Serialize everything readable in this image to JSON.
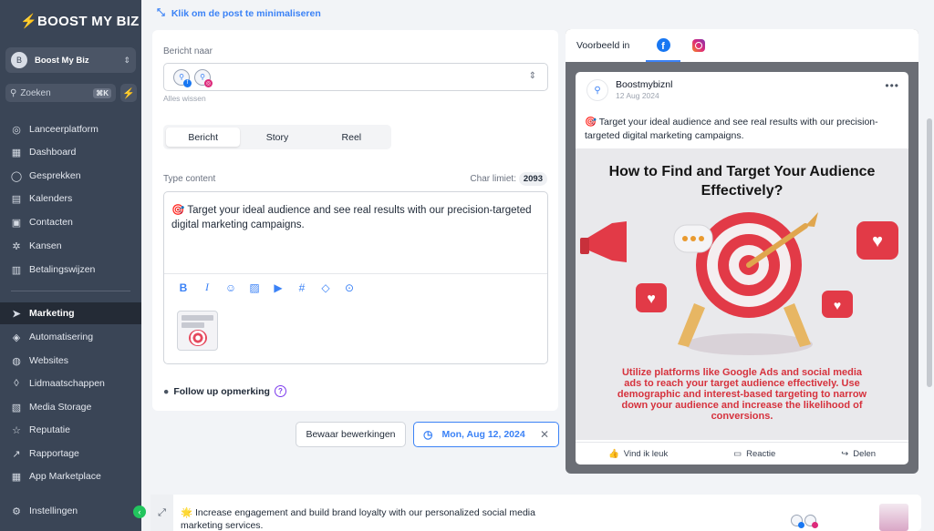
{
  "app": {
    "brand": "BOOST MY BIZ",
    "account_name": "Boost My Biz",
    "account_initial": "B",
    "search_placeholder": "Zoeken",
    "search_shortcut": "⌘K"
  },
  "sidebar": {
    "items": [
      {
        "label": "Lanceerplatform",
        "icon": "rocket-icon"
      },
      {
        "label": "Dashboard",
        "icon": "dashboard-icon"
      },
      {
        "label": "Gesprekken",
        "icon": "chat-icon"
      },
      {
        "label": "Kalenders",
        "icon": "calendar-icon"
      },
      {
        "label": "Contacten",
        "icon": "contacts-icon"
      },
      {
        "label": "Kansen",
        "icon": "opportunities-icon"
      },
      {
        "label": "Betalingswijzen",
        "icon": "payments-icon"
      },
      {
        "label": "Marketing",
        "icon": "send-icon",
        "active": true
      },
      {
        "label": "Automatisering",
        "icon": "automation-icon"
      },
      {
        "label": "Websites",
        "icon": "globe-icon"
      },
      {
        "label": "Lidmaatschappen",
        "icon": "membership-icon"
      },
      {
        "label": "Media Storage",
        "icon": "image-icon"
      },
      {
        "label": "Reputatie",
        "icon": "star-icon"
      },
      {
        "label": "Rapportage",
        "icon": "trend-icon"
      },
      {
        "label": "App Marketplace",
        "icon": "grid-icon"
      },
      {
        "label": "Instellingen",
        "icon": "gear-icon"
      }
    ]
  },
  "top": {
    "minimize_label": "Klik om de post te minimaliseren"
  },
  "editor": {
    "recipients_label": "Bericht naar",
    "clear_all": "Alles wissen",
    "tabs": [
      {
        "label": "Bericht",
        "active": true
      },
      {
        "label": "Story"
      },
      {
        "label": "Reel"
      }
    ],
    "content_label": "Type content",
    "char_limit_label": "Char limiet:",
    "char_limit_value": "2093",
    "content_emoji": "🎯",
    "content_text": "Target your ideal audience and see real results with our precision-targeted digital marketing campaigns.",
    "toolbar": [
      "bold-icon",
      "italic-icon",
      "emoji-icon",
      "image-icon",
      "video-icon",
      "hashtag-icon",
      "tag-icon",
      "location-icon"
    ],
    "followup_label": "Follow up opmerking"
  },
  "actions": {
    "save_label": "Bewaar bewerkingen",
    "date_label": "Mon, Aug 12, 2024"
  },
  "preview": {
    "label": "Voorbeeld in",
    "page_name": "Boostmybiznl",
    "post_date": "12 Aug 2024",
    "post_text": "🎯 Target your ideal audience and see real results with our precision-targeted digital marketing campaigns.",
    "image_title": "How to Find and Target Your Audience Effectively?",
    "image_body": "Utilize platforms like Google Ads and social media ads to reach your target audience effectively. Use demographic and interest-based targeting to narrow down your audience and increase the likelihood of conversions.",
    "like_label": "Vind ik leuk",
    "comment_label": "Reactie",
    "share_label": "Delen"
  },
  "bottom_post": {
    "emoji": "🌟",
    "text": "Increase engagement and build brand loyalty with our personalized social media marketing services."
  },
  "colors": {
    "sidebar_bg": "#3a4556",
    "sidebar_active": "#242b36",
    "accent": "#3b82f6",
    "facebook": "#1877f2",
    "target_red": "#d6323d"
  }
}
